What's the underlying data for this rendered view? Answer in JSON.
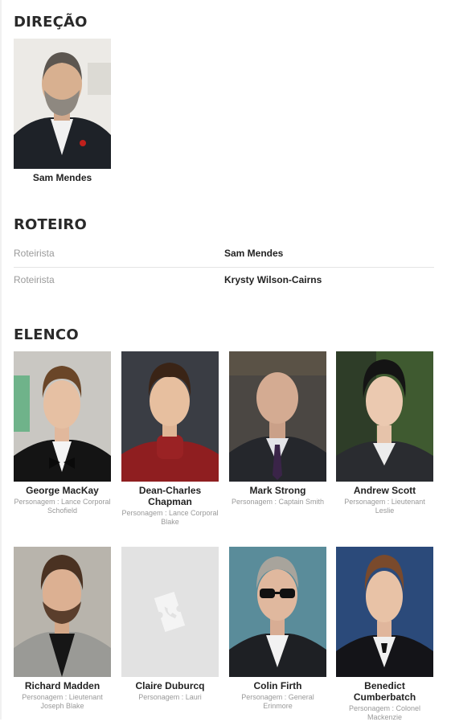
{
  "direcao": {
    "title": "DIREÇÃO",
    "people": [
      {
        "name": "Sam Mendes"
      }
    ]
  },
  "roteiro": {
    "title": "ROTEIRO",
    "rows": [
      {
        "label": "Roteirista",
        "value": "Sam Mendes"
      },
      {
        "label": "Roteirista",
        "value": "Krysty Wilson-Cairns"
      }
    ]
  },
  "elenco": {
    "title": "ELENCO",
    "cast": [
      {
        "name": "George MacKay",
        "role": "Personagem : Lance Corporal Schofield"
      },
      {
        "name": "Dean-Charles Chapman",
        "role": "Personagem : Lance Corporal Blake"
      },
      {
        "name": "Mark Strong",
        "role": "Personagem : Captain Smith"
      },
      {
        "name": "Andrew Scott",
        "role": "Personagem : Lieutenant Leslie"
      },
      {
        "name": "Richard Madden",
        "role": "Personagem : Lieutenant Joseph Blake"
      },
      {
        "name": "Claire Duburcq",
        "role": "Personagem : Lauri"
      },
      {
        "name": "Colin Firth",
        "role": "Personagem : General Erinmore"
      },
      {
        "name": "Benedict Cumberbatch",
        "role": "Personagem : Colonel Mackenzie"
      }
    ]
  },
  "colors": {
    "placeholder_bg": "#e2e2e2",
    "placeholder_icon": "#f4f4f4",
    "muted_text": "#999999"
  },
  "icons": {
    "placeholder": "ticket-icon"
  }
}
